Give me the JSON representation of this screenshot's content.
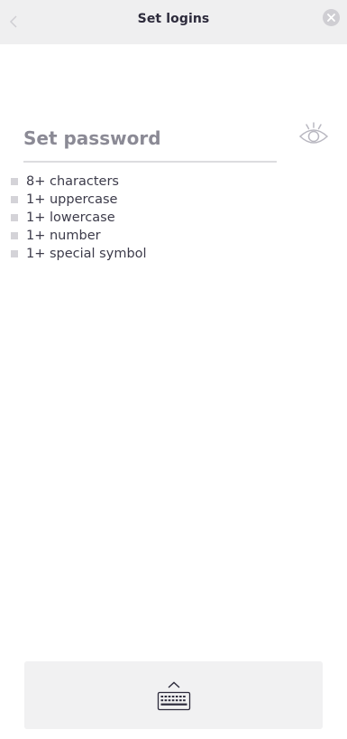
{
  "header": {
    "title": "Set logins"
  },
  "password": {
    "placeholder": "Set password",
    "value": ""
  },
  "requirements": [
    {
      "label": "8+ characters"
    },
    {
      "label": "1+ uppercase"
    },
    {
      "label": "1+ lowercase"
    },
    {
      "label": "1+ number"
    },
    {
      "label": "1+ special symbol"
    }
  ],
  "icons": {
    "back": "chevron-left-icon",
    "close": "close-icon",
    "toggle_visibility": "eye-icon",
    "keyboard": "keyboard-icon"
  },
  "colors": {
    "header_bg": "#efeff0",
    "title": "#2d2b3c",
    "placeholder": "#8b8a95",
    "text": "#3c3b4a",
    "muted_icon": "#cfced3",
    "marker": "#d4d3d8"
  }
}
